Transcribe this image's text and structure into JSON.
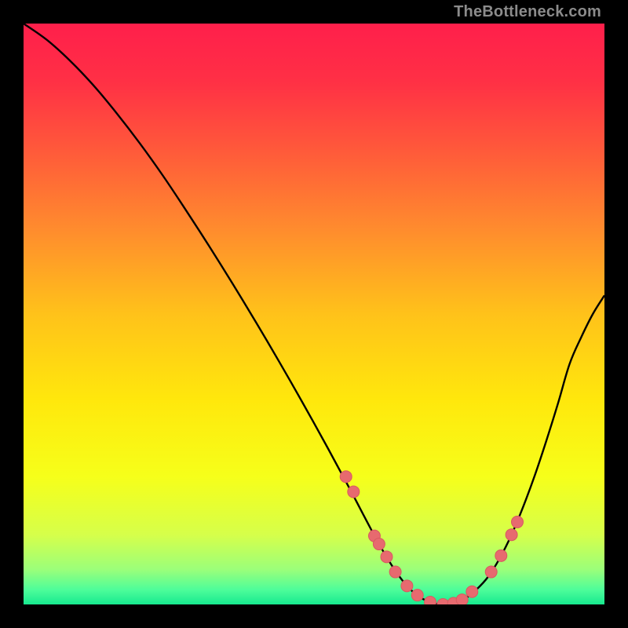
{
  "watermark": "TheBottleneck.com",
  "colors": {
    "background": "#000000",
    "curve_stroke": "#000000",
    "dot_fill": "#e76a6f",
    "dot_stroke": "#d85a60"
  },
  "chart_data": {
    "type": "line",
    "title": "",
    "xlabel": "",
    "ylabel": "",
    "xlim": [
      0,
      100
    ],
    "ylim": [
      0,
      100
    ],
    "gradient_stops": [
      {
        "offset": 0.0,
        "color": "#ff1f4b"
      },
      {
        "offset": 0.1,
        "color": "#ff3045"
      },
      {
        "offset": 0.22,
        "color": "#ff5a3a"
      },
      {
        "offset": 0.35,
        "color": "#ff8a2e"
      },
      {
        "offset": 0.5,
        "color": "#ffc21a"
      },
      {
        "offset": 0.65,
        "color": "#ffe80c"
      },
      {
        "offset": 0.78,
        "color": "#f6ff1a"
      },
      {
        "offset": 0.88,
        "color": "#d6ff4a"
      },
      {
        "offset": 0.94,
        "color": "#9bff7a"
      },
      {
        "offset": 0.975,
        "color": "#4dfd9a"
      },
      {
        "offset": 1.0,
        "color": "#17e98f"
      }
    ],
    "series": [
      {
        "name": "bottleneck-curve",
        "x": [
          0,
          4,
          8,
          12,
          16,
          20,
          24,
          28,
          32,
          36,
          40,
          44,
          48,
          52,
          56,
          58,
          60,
          62,
          64,
          66,
          68,
          70,
          72,
          74,
          76,
          78,
          80,
          82,
          84,
          86,
          88,
          90,
          92,
          94,
          96,
          98,
          100
        ],
        "y": [
          100,
          97.2,
          93.6,
          89.4,
          84.6,
          79.4,
          73.8,
          67.8,
          61.6,
          55.2,
          48.6,
          41.8,
          34.8,
          27.6,
          20.2,
          16.4,
          12.6,
          9.0,
          5.8,
          3.2,
          1.4,
          0.4,
          0.0,
          0.2,
          1.0,
          2.6,
          4.8,
          8.0,
          12.0,
          16.8,
          22.2,
          28.2,
          34.6,
          41.4,
          46.0,
          50.0,
          53.2
        ]
      }
    ],
    "dots": {
      "name": "highlight-dots",
      "x": [
        55.5,
        56.8,
        60.4,
        61.2,
        62.5,
        64.0,
        66.0,
        67.8,
        70.0,
        72.2,
        74.0,
        75.5,
        77.2,
        80.5,
        82.2,
        84.0,
        85.0
      ],
      "y": [
        22.0,
        19.4,
        11.8,
        10.4,
        8.2,
        5.6,
        3.2,
        1.6,
        0.4,
        0.0,
        0.2,
        0.8,
        2.2,
        5.6,
        8.4,
        12.0,
        14.2
      ]
    }
  }
}
